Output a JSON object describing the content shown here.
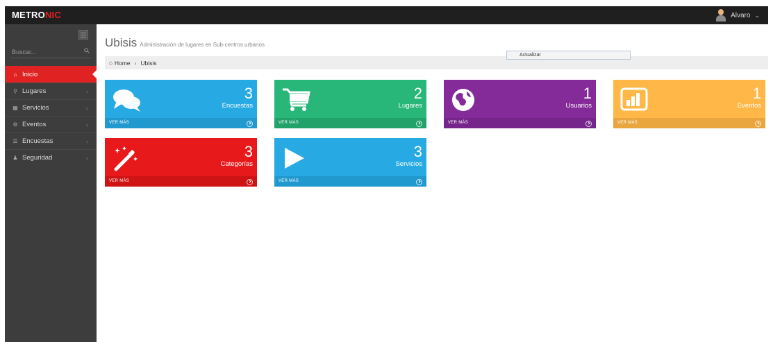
{
  "header": {
    "logo_part1": "METRO",
    "logo_part2": "NIC",
    "user_name": "Alvaro",
    "user_chevron": "⌄"
  },
  "sidebar": {
    "search_placeholder": "Buscar...",
    "items": [
      {
        "label": "Inicio",
        "icon": "home-icon",
        "glyph": "⌂",
        "active": true
      },
      {
        "label": "Lugares",
        "icon": "map-pin-icon",
        "glyph": "⚲"
      },
      {
        "label": "Servicios",
        "icon": "chart-icon",
        "glyph": "▦"
      },
      {
        "label": "Eventos",
        "icon": "gear-icon",
        "glyph": "⚙"
      },
      {
        "label": "Encuestas",
        "icon": "list-icon",
        "glyph": "☰"
      },
      {
        "label": "Seguridad",
        "icon": "user-icon",
        "glyph": "♟"
      }
    ],
    "arrow": "‹"
  },
  "page": {
    "title": "Ubisis",
    "subtitle": "Administración de lugares en Sub-centros urbanos",
    "update_button": "Actualizar"
  },
  "breadcrumb": {
    "home": "Home",
    "separator": "›",
    "current": "Ubisis"
  },
  "tiles": [
    {
      "number": "3",
      "label": "Encuestas",
      "more": "VER MÁS",
      "icon": "comments-icon",
      "color": "#27a9e3",
      "footer_color": "#2199cf"
    },
    {
      "number": "2",
      "label": "Lugares",
      "more": "VER MÁS",
      "icon": "shopping-cart-icon",
      "color": "#28b779",
      "footer_color": "#21a26b"
    },
    {
      "number": "1",
      "label": "Usuarios",
      "more": "VER MÁS",
      "icon": "globe-icon",
      "color": "#852b99",
      "footer_color": "#76258a"
    },
    {
      "number": "1",
      "label": "Eventos",
      "more": "VER MÁS",
      "icon": "bar-chart-icon",
      "color": "#ffb848",
      "footer_color": "#e9a63e"
    },
    {
      "number": "3",
      "label": "Categorías",
      "more": "VER MÁS",
      "icon": "magic-wand-icon",
      "color": "#e7191b",
      "footer_color": "#cf1416"
    },
    {
      "number": "3",
      "label": "Servicios",
      "more": "VER MÁS",
      "icon": "play-icon",
      "color": "#27a9e3",
      "footer_color": "#2199cf"
    }
  ]
}
